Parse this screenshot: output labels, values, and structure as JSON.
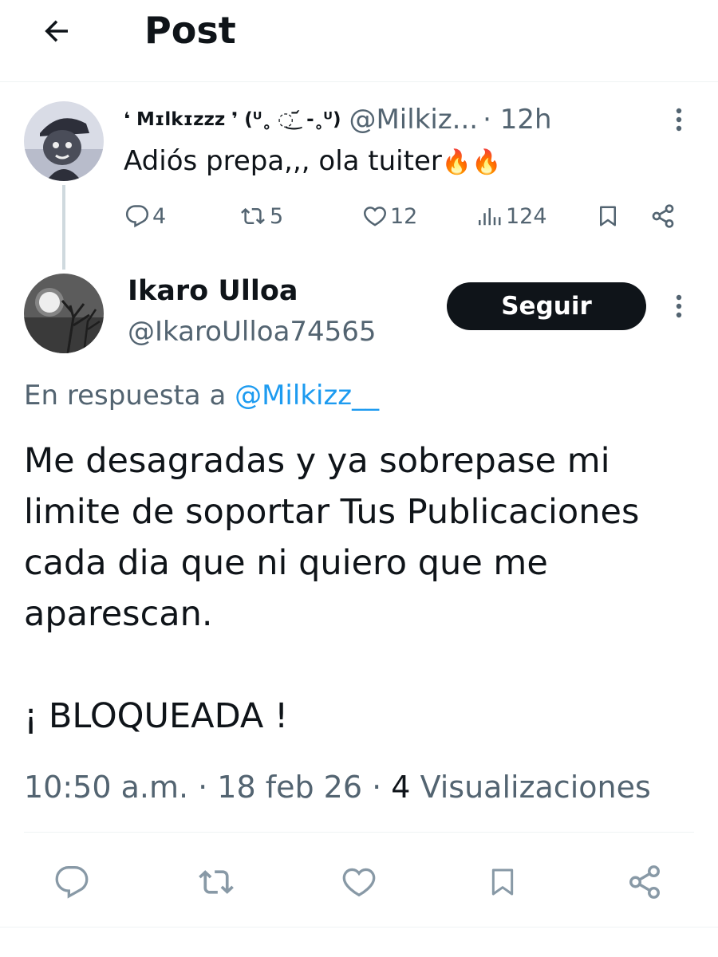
{
  "header": {
    "title": "Post",
    "back_icon": "arrow-left-icon"
  },
  "parent_tweet": {
    "display_name": "❛ Mɪlkɪzzz ❜ (ᵁ˳ ◌͜ ᷄ -˳ᵁ)",
    "handle": "@Milkiz...",
    "time": "· 12h",
    "text": "Adiós prepa,,, ola tuiter",
    "emoji": "🔥🔥",
    "replies": "4",
    "reposts": "5",
    "likes": "12",
    "views": "124"
  },
  "main_tweet": {
    "author_name": "Ikaro Ulloa",
    "author_handle": "@IkaroUlloa74565",
    "follow_label": "Seguir",
    "reply_prefix": "En respuesta a",
    "reply_handle": "@Milkizz__",
    "lines": [
      "Me desagradas y ya sobrepase mi",
      "limite de soportar Tus Publicaciones",
      "cada dia que ni quiero que me",
      "aparescan.",
      "¡ BLOQUEADA !"
    ],
    "meta_time": "10:50 a.m. · 18 feb 26 · ",
    "meta_views_count": "4",
    "meta_views_label": "Visualizaciones"
  },
  "colors": {
    "text": "#0f1419",
    "muted": "#536471",
    "link": "#1d9bf0",
    "divider": "#eff3f4"
  }
}
